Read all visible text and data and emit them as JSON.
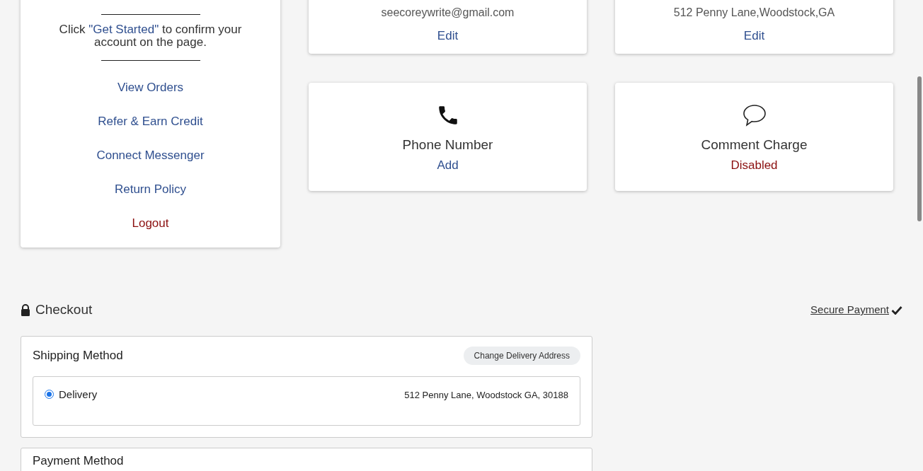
{
  "account_panel": {
    "confirm_prefix": "Click",
    "confirm_link": "\"Get Started\"",
    "confirm_suffix": "to confirm your account on the page.",
    "links": [
      {
        "label": "View Orders",
        "kind": "link"
      },
      {
        "label": "Refer & Earn Credit",
        "kind": "link"
      },
      {
        "label": "Connect Messenger",
        "kind": "link"
      },
      {
        "label": "Return Policy",
        "kind": "link"
      },
      {
        "label": "Logout",
        "kind": "danger"
      }
    ]
  },
  "cards": [
    {
      "kind": "text",
      "value": "seecoreywrite@gmail.com",
      "action": {
        "label": "Edit",
        "kind": "link"
      }
    },
    {
      "kind": "text",
      "value": "512 Penny Lane,Woodstock,GA",
      "action": {
        "label": "Edit",
        "kind": "link"
      }
    },
    {
      "kind": "phone",
      "title": "Phone Number",
      "action": {
        "label": "Add",
        "kind": "link"
      }
    },
    {
      "kind": "comment",
      "title": "Comment Charge",
      "action": {
        "label": "Disabled",
        "kind": "danger"
      }
    }
  ],
  "checkout": {
    "title": "Checkout",
    "secure_link": "Secure Payment",
    "shipping": {
      "title": "Shipping Method",
      "button": "Change Delivery Address",
      "options": [
        {
          "label": "Delivery",
          "selected": true,
          "address": "512 Penny Lane, Woodstock GA, 30188"
        }
      ]
    },
    "payment": {
      "title": "Payment Method"
    }
  }
}
